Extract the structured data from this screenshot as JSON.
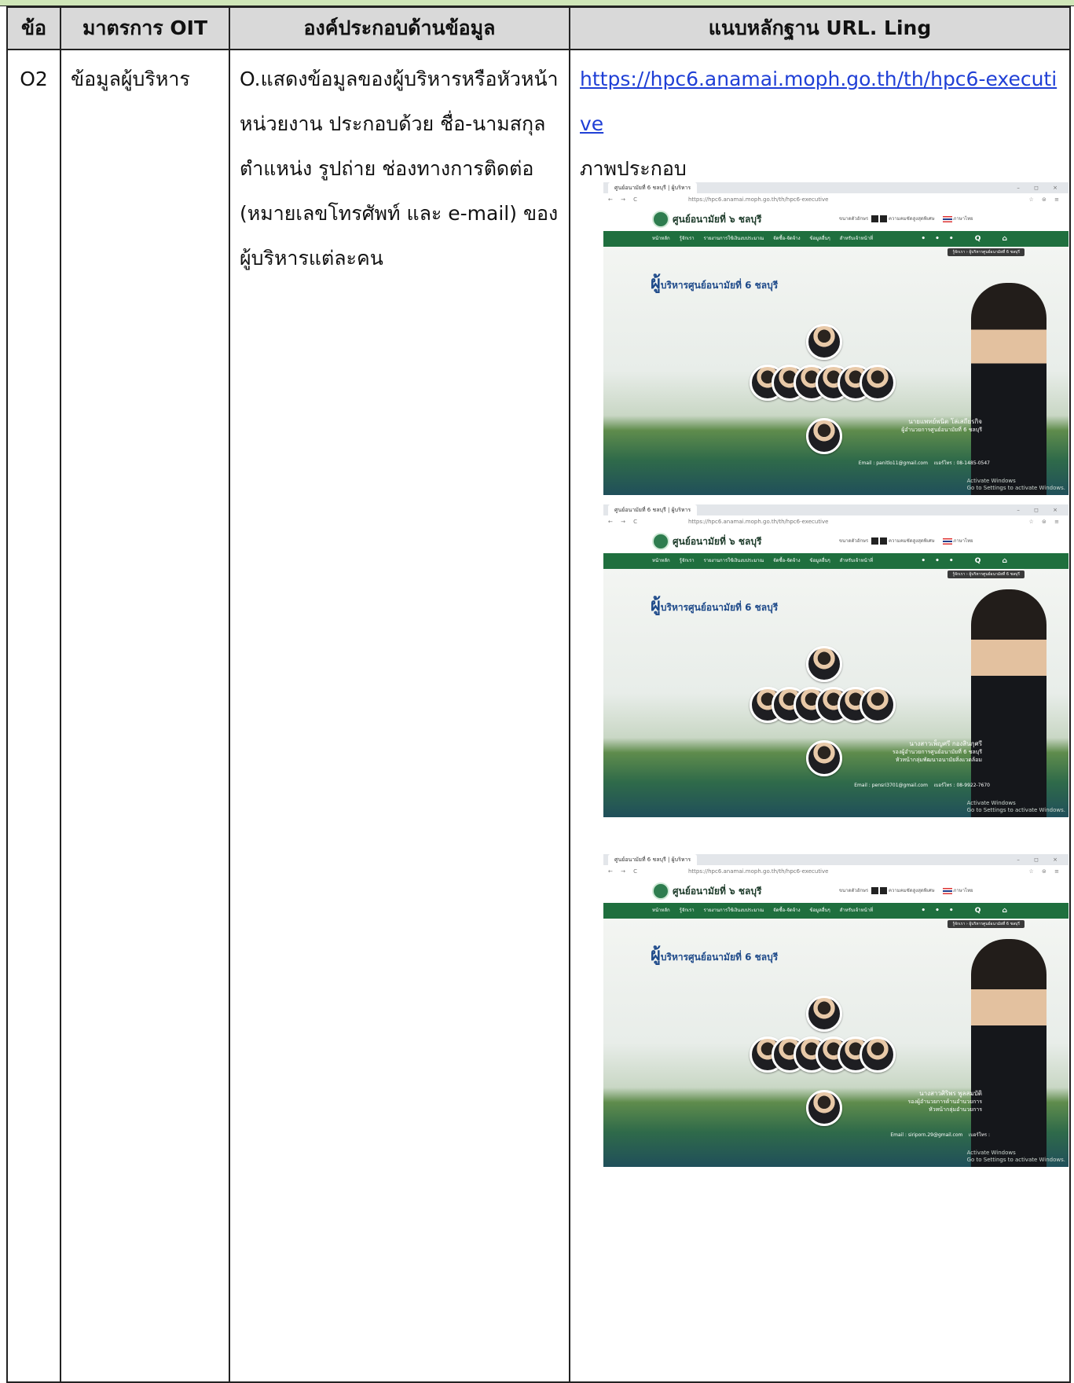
{
  "table": {
    "headers": [
      "ข้อ",
      "มาตรการ OIT",
      "องค์ประกอบด้านข้อมูล",
      "แนบหลักฐาน URL. Ling"
    ],
    "row": {
      "number": "O2",
      "measure": "ข้อมูลผู้บริหาร",
      "description": "O.แสดงข้อมูลของผู้บริหารหรือหัวหน้าหน่วยงาน ประกอบด้วย ชื่อ-นามสกุล ตำแหน่ง รูปถ่าย ช่องทางการติดต่อ (หมายเลขโทรศัพท์ และ e-mail) ของผู้บริหารแต่ละคน",
      "link": "https://hpc6.anamai.moph.go.th/th/hpc6-executive",
      "caption": "ภาพประกอบ"
    }
  },
  "screenshots": [
    {
      "tab": "ศูนย์อนามัยที่ 6 ชลบุรี | ผู้บริหาร",
      "url": "https://hpc6.anamai.moph.go.th/th/hpc6-executive",
      "site_name": "ศูนย์อนามัยที่ ๖ ชลบุรี",
      "page_title": "บริหารศูนย์อนามัยที่ 6 ชลบุรี",
      "page_title_initial": "ผู้",
      "person_name": "นายแพทย์พนิต โล่เสถียรกิจ",
      "person_role": "ผู้อำนวยการศูนย์อนามัยที่ 6 ชลบุรี",
      "email": "Email : panitlo11@gmail.com",
      "phone": "เบอร์โทร : 08-1485-0547",
      "watermark": "Activate Windows\nGo to Settings to activate Windows."
    },
    {
      "tab": "ศูนย์อนามัยที่ 6 ชลบุรี | ผู้บริหาร",
      "url": "https://hpc6.anamai.moph.go.th/th/hpc6-executive",
      "site_name": "ศูนย์อนามัยที่ ๖ ชลบุรี",
      "page_title": "บริหารศูนย์อนามัยที่ 6 ชลบุรี",
      "page_title_initial": "ผู้",
      "person_name": "นางสาวเพ็ญศรี กองสินกุศรี",
      "person_role": "รองผู้อำนวยการศูนย์อนามัยที่ 6 ชลบุรี\nหัวหน้ากลุ่มพัฒนาอนามัยสิ่งแวดล้อม",
      "email": "Email : pensri3701@gmail.com",
      "phone": "เบอร์โทร : 08-9922-7670",
      "watermark": "Activate Windows\nGo to Settings to activate Windows."
    },
    {
      "tab": "ศูนย์อนามัยที่ 6 ชลบุรี | ผู้บริหาร",
      "url": "https://hpc6.anamai.moph.go.th/th/hpc6-executive",
      "site_name": "ศูนย์อนามัยที่ ๖ ชลบุรี",
      "page_title": "บริหารศูนย์อนามัยที่ 6 ชลบุรี",
      "page_title_initial": "ผู้",
      "person_name": "นางสาวศิริพร พูลสมบัติ",
      "person_role": "รองผู้อำนวยการด้านอำนวยการ\nหัวหน้ากลุ่มอำนวยการ",
      "email": "Email : siriporn.29@gmail.com",
      "phone": "เบอร์โทร :",
      "watermark": "Activate Windows\nGo to Settings to activate Windows."
    }
  ],
  "browser_ui": {
    "nav_buttons": "← → C",
    "window_controls": "– ◻ ×",
    "menu_items": "หน้าหลัก รู้จักเรา รายงานการใช้เงินงบประมาณ จัดซื้อ-จัดจ้าง ข้อมูลอื่นๆ สำหรับเจ้าหน้าที่",
    "menu_icons": "••• Q ⌂",
    "font_size_label": "ขนาดตัวอักษร",
    "contrast_label": "ความคมชัดสูงสุดพิเศษ",
    "language": "ภาษาไทย",
    "breadcrumb": "รู้จักเรา › ผู้บริหารศูนย์อนามัยที่ 6 ชลบุรี"
  }
}
